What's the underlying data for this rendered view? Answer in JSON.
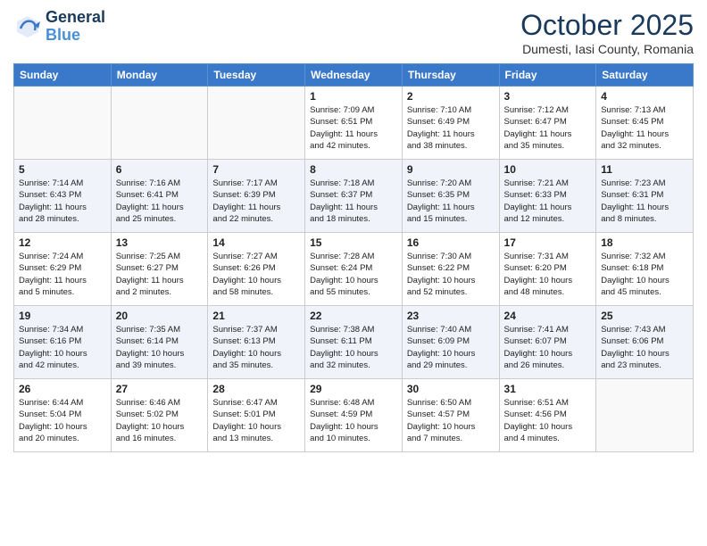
{
  "header": {
    "logo_line1": "General",
    "logo_line2": "Blue",
    "month": "October 2025",
    "location": "Dumesti, Iasi County, Romania"
  },
  "days_of_week": [
    "Sunday",
    "Monday",
    "Tuesday",
    "Wednesday",
    "Thursday",
    "Friday",
    "Saturday"
  ],
  "weeks": [
    [
      {
        "day": "",
        "info": ""
      },
      {
        "day": "",
        "info": ""
      },
      {
        "day": "",
        "info": ""
      },
      {
        "day": "1",
        "info": "Sunrise: 7:09 AM\nSunset: 6:51 PM\nDaylight: 11 hours\nand 42 minutes."
      },
      {
        "day": "2",
        "info": "Sunrise: 7:10 AM\nSunset: 6:49 PM\nDaylight: 11 hours\nand 38 minutes."
      },
      {
        "day": "3",
        "info": "Sunrise: 7:12 AM\nSunset: 6:47 PM\nDaylight: 11 hours\nand 35 minutes."
      },
      {
        "day": "4",
        "info": "Sunrise: 7:13 AM\nSunset: 6:45 PM\nDaylight: 11 hours\nand 32 minutes."
      }
    ],
    [
      {
        "day": "5",
        "info": "Sunrise: 7:14 AM\nSunset: 6:43 PM\nDaylight: 11 hours\nand 28 minutes."
      },
      {
        "day": "6",
        "info": "Sunrise: 7:16 AM\nSunset: 6:41 PM\nDaylight: 11 hours\nand 25 minutes."
      },
      {
        "day": "7",
        "info": "Sunrise: 7:17 AM\nSunset: 6:39 PM\nDaylight: 11 hours\nand 22 minutes."
      },
      {
        "day": "8",
        "info": "Sunrise: 7:18 AM\nSunset: 6:37 PM\nDaylight: 11 hours\nand 18 minutes."
      },
      {
        "day": "9",
        "info": "Sunrise: 7:20 AM\nSunset: 6:35 PM\nDaylight: 11 hours\nand 15 minutes."
      },
      {
        "day": "10",
        "info": "Sunrise: 7:21 AM\nSunset: 6:33 PM\nDaylight: 11 hours\nand 12 minutes."
      },
      {
        "day": "11",
        "info": "Sunrise: 7:23 AM\nSunset: 6:31 PM\nDaylight: 11 hours\nand 8 minutes."
      }
    ],
    [
      {
        "day": "12",
        "info": "Sunrise: 7:24 AM\nSunset: 6:29 PM\nDaylight: 11 hours\nand 5 minutes."
      },
      {
        "day": "13",
        "info": "Sunrise: 7:25 AM\nSunset: 6:27 PM\nDaylight: 11 hours\nand 2 minutes."
      },
      {
        "day": "14",
        "info": "Sunrise: 7:27 AM\nSunset: 6:26 PM\nDaylight: 10 hours\nand 58 minutes."
      },
      {
        "day": "15",
        "info": "Sunrise: 7:28 AM\nSunset: 6:24 PM\nDaylight: 10 hours\nand 55 minutes."
      },
      {
        "day": "16",
        "info": "Sunrise: 7:30 AM\nSunset: 6:22 PM\nDaylight: 10 hours\nand 52 minutes."
      },
      {
        "day": "17",
        "info": "Sunrise: 7:31 AM\nSunset: 6:20 PM\nDaylight: 10 hours\nand 48 minutes."
      },
      {
        "day": "18",
        "info": "Sunrise: 7:32 AM\nSunset: 6:18 PM\nDaylight: 10 hours\nand 45 minutes."
      }
    ],
    [
      {
        "day": "19",
        "info": "Sunrise: 7:34 AM\nSunset: 6:16 PM\nDaylight: 10 hours\nand 42 minutes."
      },
      {
        "day": "20",
        "info": "Sunrise: 7:35 AM\nSunset: 6:14 PM\nDaylight: 10 hours\nand 39 minutes."
      },
      {
        "day": "21",
        "info": "Sunrise: 7:37 AM\nSunset: 6:13 PM\nDaylight: 10 hours\nand 35 minutes."
      },
      {
        "day": "22",
        "info": "Sunrise: 7:38 AM\nSunset: 6:11 PM\nDaylight: 10 hours\nand 32 minutes."
      },
      {
        "day": "23",
        "info": "Sunrise: 7:40 AM\nSunset: 6:09 PM\nDaylight: 10 hours\nand 29 minutes."
      },
      {
        "day": "24",
        "info": "Sunrise: 7:41 AM\nSunset: 6:07 PM\nDaylight: 10 hours\nand 26 minutes."
      },
      {
        "day": "25",
        "info": "Sunrise: 7:43 AM\nSunset: 6:06 PM\nDaylight: 10 hours\nand 23 minutes."
      }
    ],
    [
      {
        "day": "26",
        "info": "Sunrise: 6:44 AM\nSunset: 5:04 PM\nDaylight: 10 hours\nand 20 minutes."
      },
      {
        "day": "27",
        "info": "Sunrise: 6:46 AM\nSunset: 5:02 PM\nDaylight: 10 hours\nand 16 minutes."
      },
      {
        "day": "28",
        "info": "Sunrise: 6:47 AM\nSunset: 5:01 PM\nDaylight: 10 hours\nand 13 minutes."
      },
      {
        "day": "29",
        "info": "Sunrise: 6:48 AM\nSunset: 4:59 PM\nDaylight: 10 hours\nand 10 minutes."
      },
      {
        "day": "30",
        "info": "Sunrise: 6:50 AM\nSunset: 4:57 PM\nDaylight: 10 hours\nand 7 minutes."
      },
      {
        "day": "31",
        "info": "Sunrise: 6:51 AM\nSunset: 4:56 PM\nDaylight: 10 hours\nand 4 minutes."
      },
      {
        "day": "",
        "info": ""
      }
    ]
  ]
}
